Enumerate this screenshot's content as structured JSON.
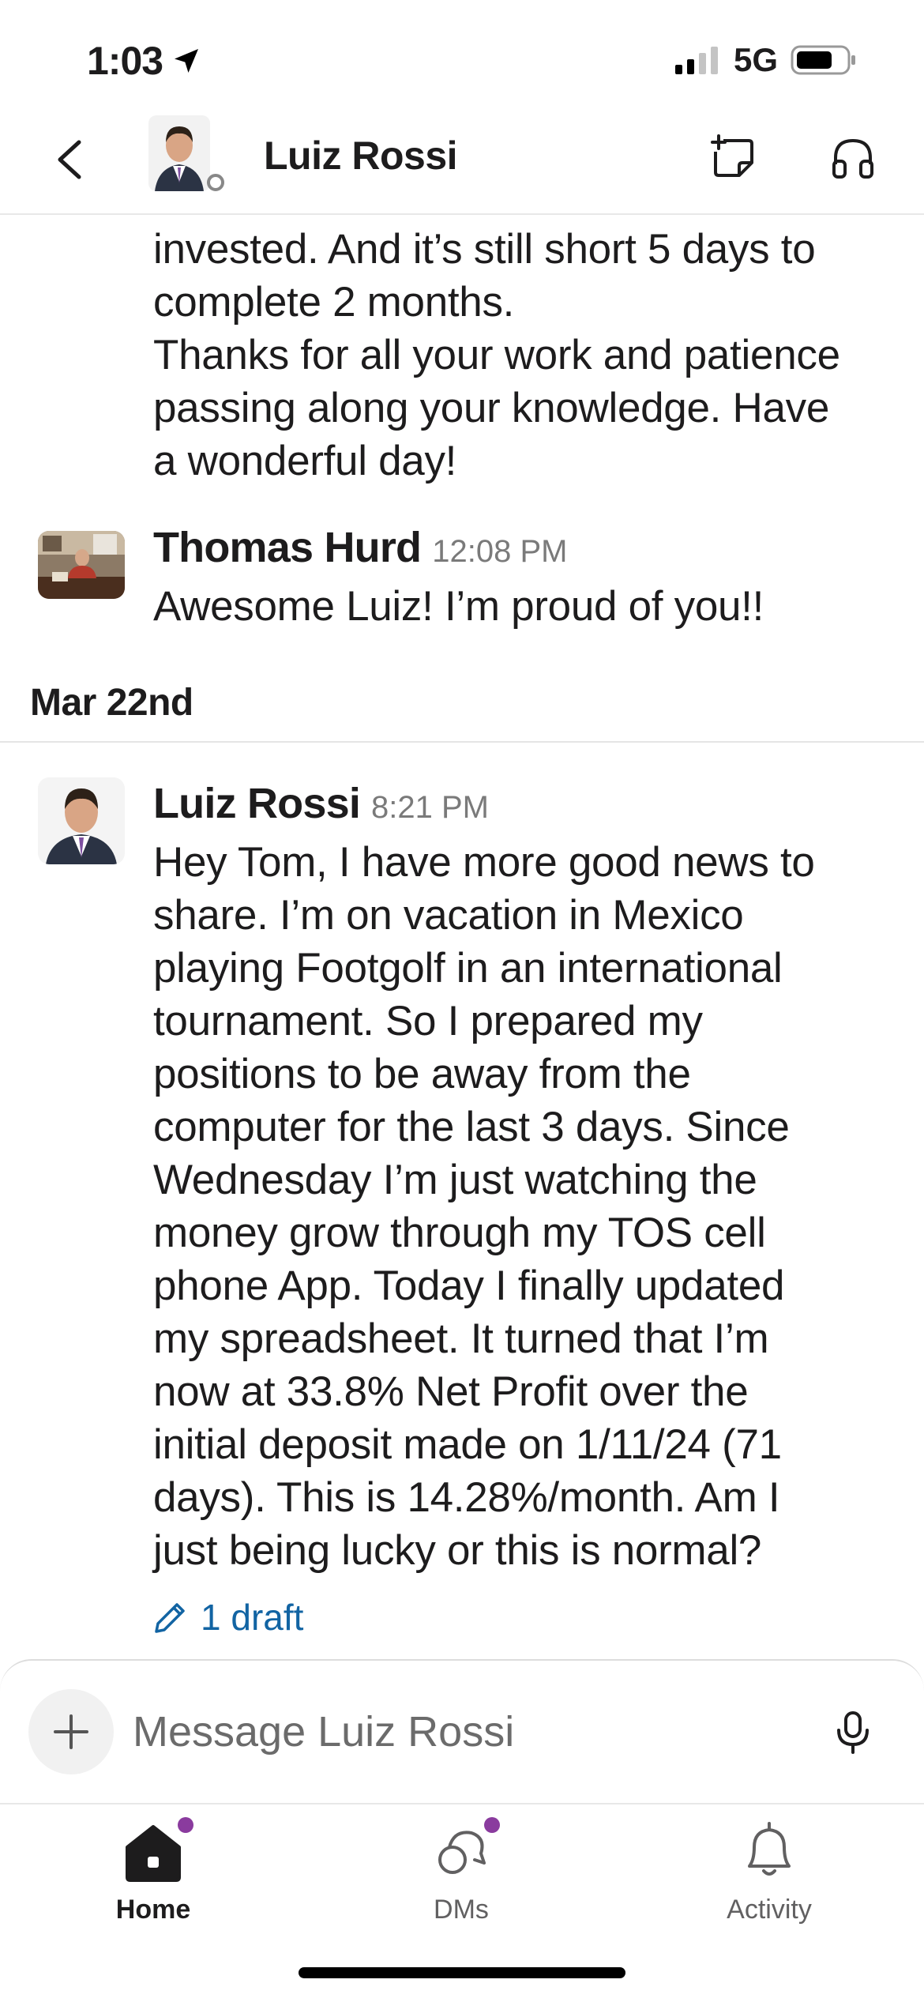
{
  "status_bar": {
    "time": "1:03",
    "network": "5G"
  },
  "header": {
    "title": "Luiz Rossi"
  },
  "messages": [
    {
      "continued_text_lines": [
        "invested. And it’s still short 5 days to",
        "complete 2 months.",
        "Thanks for all your work and patience",
        "passing along your knowledge. Have",
        "a wonderful day!"
      ]
    },
    {
      "author": "Thomas Hurd",
      "time": "12:08 PM",
      "text": "Awesome Luiz!  I’m proud of you!!"
    }
  ],
  "date_divider": {
    "label": "Mar 22nd"
  },
  "last_message": {
    "author": "Luiz Rossi",
    "time": "8:21 PM",
    "text_lines": [
      "Hey Tom, I have more good news to",
      "share. I’m on vacation in Mexico",
      "playing Footgolf in an international",
      "tournament. So I prepared my",
      "positions to be away from the",
      "computer for the last 3 days. Since",
      "Wednesday I’m just watching the",
      "money grow through my TOS cell",
      "phone App. Today I finally updated",
      "my spreadsheet. It turned that I’m",
      "now at 33.8% Net Profit over the",
      "initial deposit made on 1/11/24 (71",
      "days). This is 14.28%/month. Am I",
      "just being lucky or this is normal?"
    ]
  },
  "draft": {
    "label": "1 draft"
  },
  "composer": {
    "placeholder": "Message Luiz Rossi"
  },
  "tabs": [
    {
      "label": "Home",
      "icon": "home-icon",
      "badge": true
    },
    {
      "label": "DMs",
      "icon": "dms-icon",
      "badge": true
    },
    {
      "label": "Activity",
      "icon": "bell-icon",
      "badge": false
    }
  ],
  "colors": {
    "link": "#1264a3",
    "badge": "#8a3b9e",
    "text": "#1d1c1d",
    "muted": "#7a7a7a"
  }
}
